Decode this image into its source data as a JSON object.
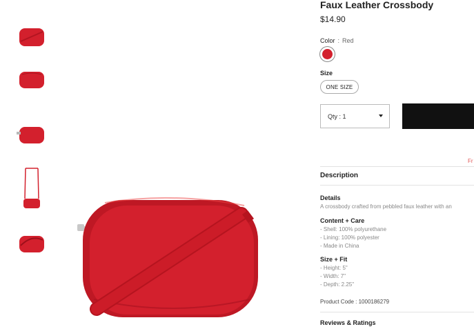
{
  "product": {
    "title": "Faux Leather Crossbody",
    "price": "$14.90",
    "product_code_label": "Product Code :",
    "product_code": "1000186279"
  },
  "color": {
    "label": "Color",
    "separator": ":",
    "value": "Red",
    "swatch_hex": "#d3202d"
  },
  "size": {
    "label": "Size",
    "option": "ONE SIZE"
  },
  "quantity": {
    "text": "Qty : 1"
  },
  "promo": {
    "text": "Fr"
  },
  "description": {
    "title": "Description",
    "details_title": "Details",
    "details_text": "A crossbody crafted from pebbled faux leather with an",
    "content_title": "Content + Care",
    "content_items": [
      "- Shell: 100% polyurethane",
      "- Lining: 100% polyester",
      "- Made in China"
    ],
    "size_title": "Size + Fit",
    "size_items": [
      "- Height: 5\"",
      "- Width: 7\"",
      "- Depth: 2.25\""
    ]
  },
  "reviews": {
    "label": "Reviews & Ratings"
  },
  "colors": {
    "bag_red": "#d3202d",
    "button_dark": "#111111"
  }
}
